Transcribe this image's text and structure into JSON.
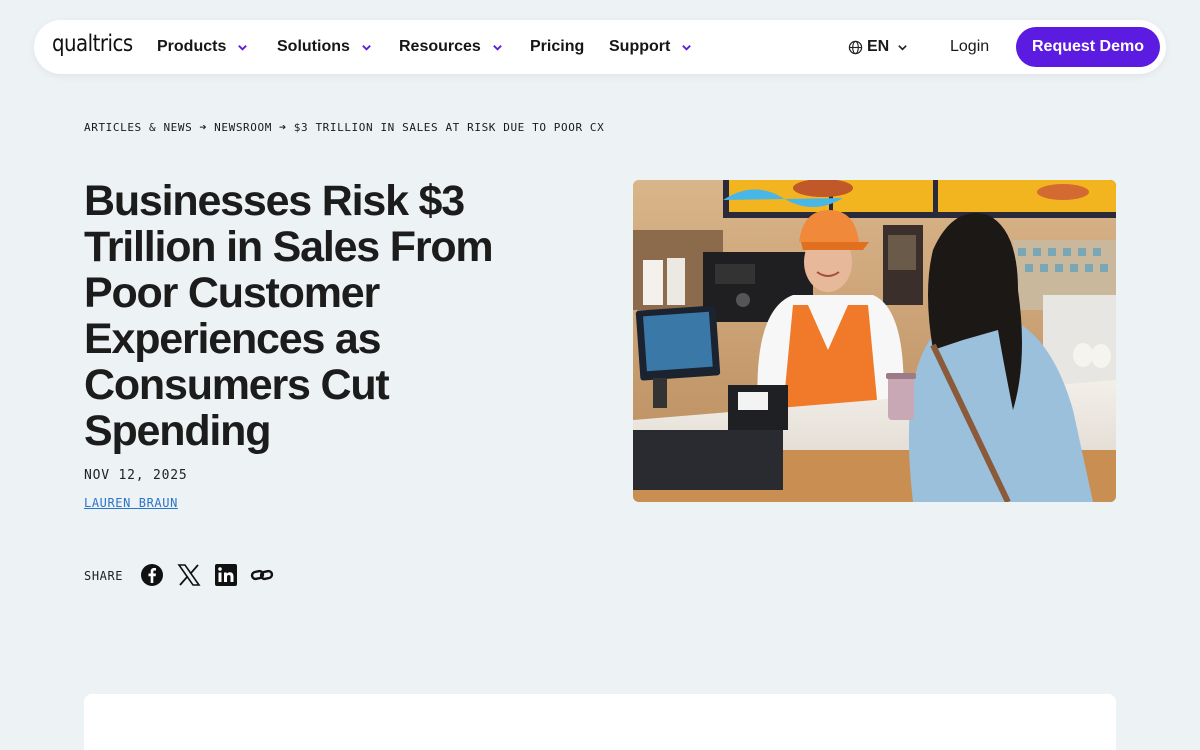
{
  "brand": {
    "logo": "qualtrics",
    "accent": "#5b1be0"
  },
  "nav": {
    "items": [
      {
        "label": "Products",
        "dropdown": true
      },
      {
        "label": "Solutions",
        "dropdown": true
      },
      {
        "label": "Resources",
        "dropdown": true
      },
      {
        "label": "Pricing",
        "dropdown": false
      },
      {
        "label": "Support",
        "dropdown": true
      }
    ],
    "language": "EN",
    "login": "Login",
    "cta": "Request Demo"
  },
  "breadcrumb": {
    "items": [
      "ARTICLES & NEWS",
      "NEWSROOM",
      "$3 TRILLION IN SALES AT RISK DUE TO POOR CX"
    ],
    "separator": "➔"
  },
  "article": {
    "title": "Businesses Risk $3 Trillion in Sales From Poor Customer Experiences as Consumers Cut Spending",
    "date": "NOV 12, 2025",
    "author": "LAUREN BRAUN"
  },
  "share": {
    "label": "SHARE",
    "icons": [
      "facebook-icon",
      "x-icon",
      "linkedin-icon",
      "link-icon"
    ]
  },
  "hero_image": {
    "subject": "cashier-serving-customer-photo"
  }
}
